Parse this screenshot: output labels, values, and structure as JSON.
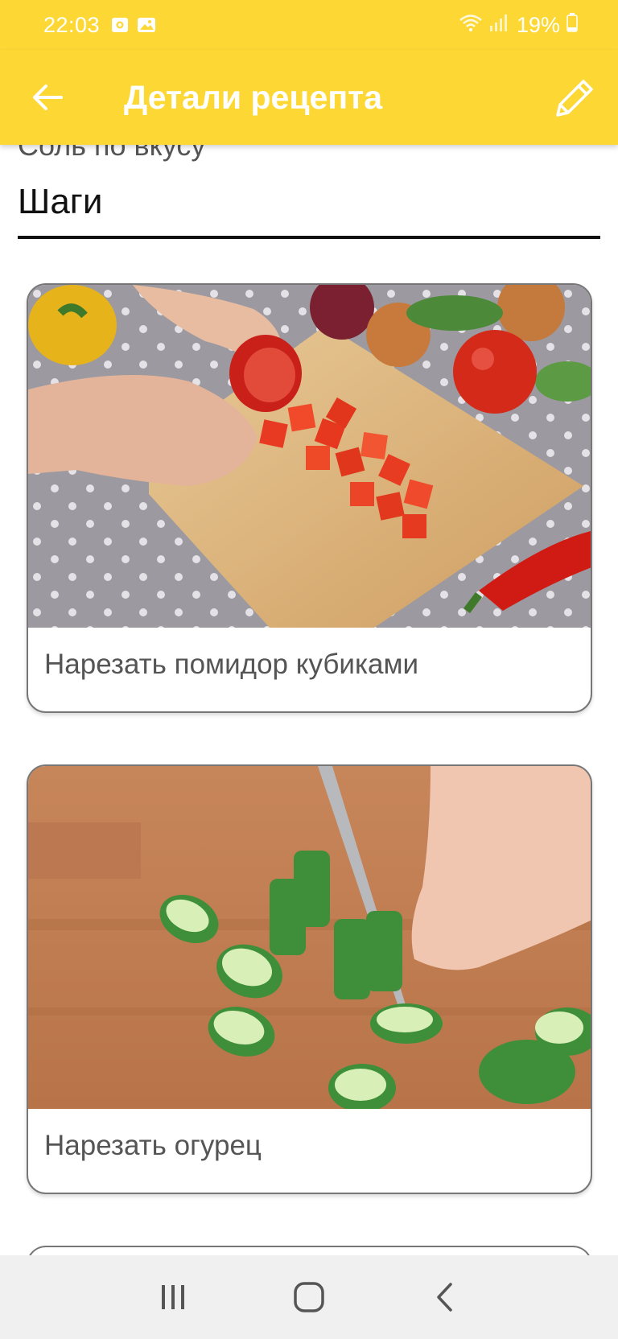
{
  "status_bar": {
    "time": "22:03",
    "battery": "19%",
    "icons": [
      "camera-notification-icon",
      "gallery-notification-icon",
      "wifi-icon",
      "signal-icon",
      "battery-icon"
    ]
  },
  "app_bar": {
    "title": "Детали рецепта",
    "back_icon": "arrow-back-icon",
    "edit_icon": "edit-pencil-icon"
  },
  "ingredients_tail": "Соль по вкусу",
  "steps_section": {
    "title": "Шаги",
    "steps": [
      {
        "caption": "Нарезать помидор кубиками",
        "photo": "tomato-cutting-photo"
      },
      {
        "caption": "Нарезать огурец",
        "photo": "cucumber-cutting-photo"
      }
    ]
  },
  "nav_bar": {
    "buttons": [
      "recents-icon",
      "home-icon",
      "back-icon"
    ]
  },
  "colors": {
    "accent": "#fdd835",
    "on_accent": "#ffffff",
    "text_primary": "#111111",
    "text_secondary": "#555555"
  }
}
